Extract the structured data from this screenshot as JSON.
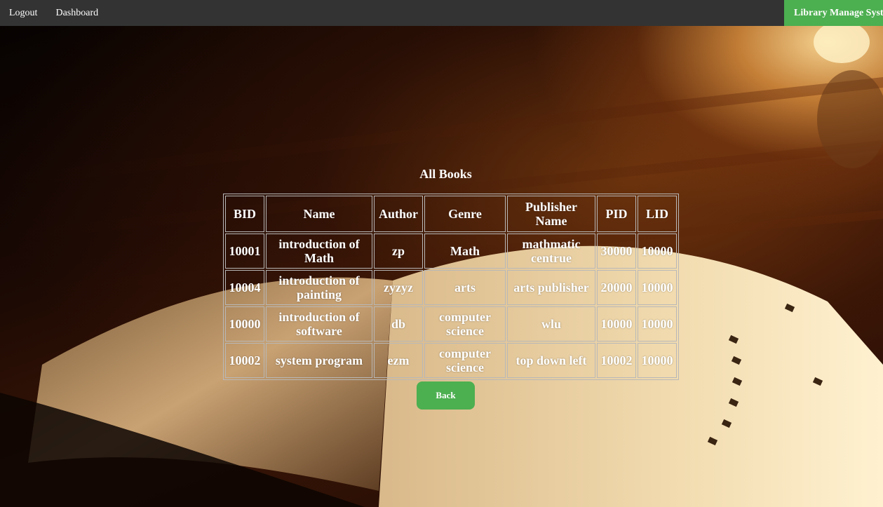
{
  "nav": {
    "links": [
      "Logout",
      "Dashboard"
    ],
    "brand": "Library Manage System",
    "bar_color": "#333333",
    "brand_color": "#4caf50"
  },
  "main": {
    "title": "All Books",
    "back_label": "Back",
    "table": {
      "headers": [
        "BID",
        "Name",
        "Author",
        "Genre",
        "Publisher Name",
        "PID",
        "LID"
      ],
      "rows": [
        [
          "10001",
          "introduction of Math",
          "zp",
          "Math",
          "mathmatic centrue",
          "30000",
          "10000"
        ],
        [
          "10004",
          "introduction of painting",
          "zyzyz",
          "arts",
          "arts publisher",
          "20000",
          "10000"
        ],
        [
          "10000",
          "introduction of software",
          "db",
          "computer science",
          "wlu",
          "10000",
          "10000"
        ],
        [
          "10002",
          "system program",
          "ezm",
          "computer science",
          "top down left",
          "10002",
          "10000"
        ]
      ]
    }
  }
}
